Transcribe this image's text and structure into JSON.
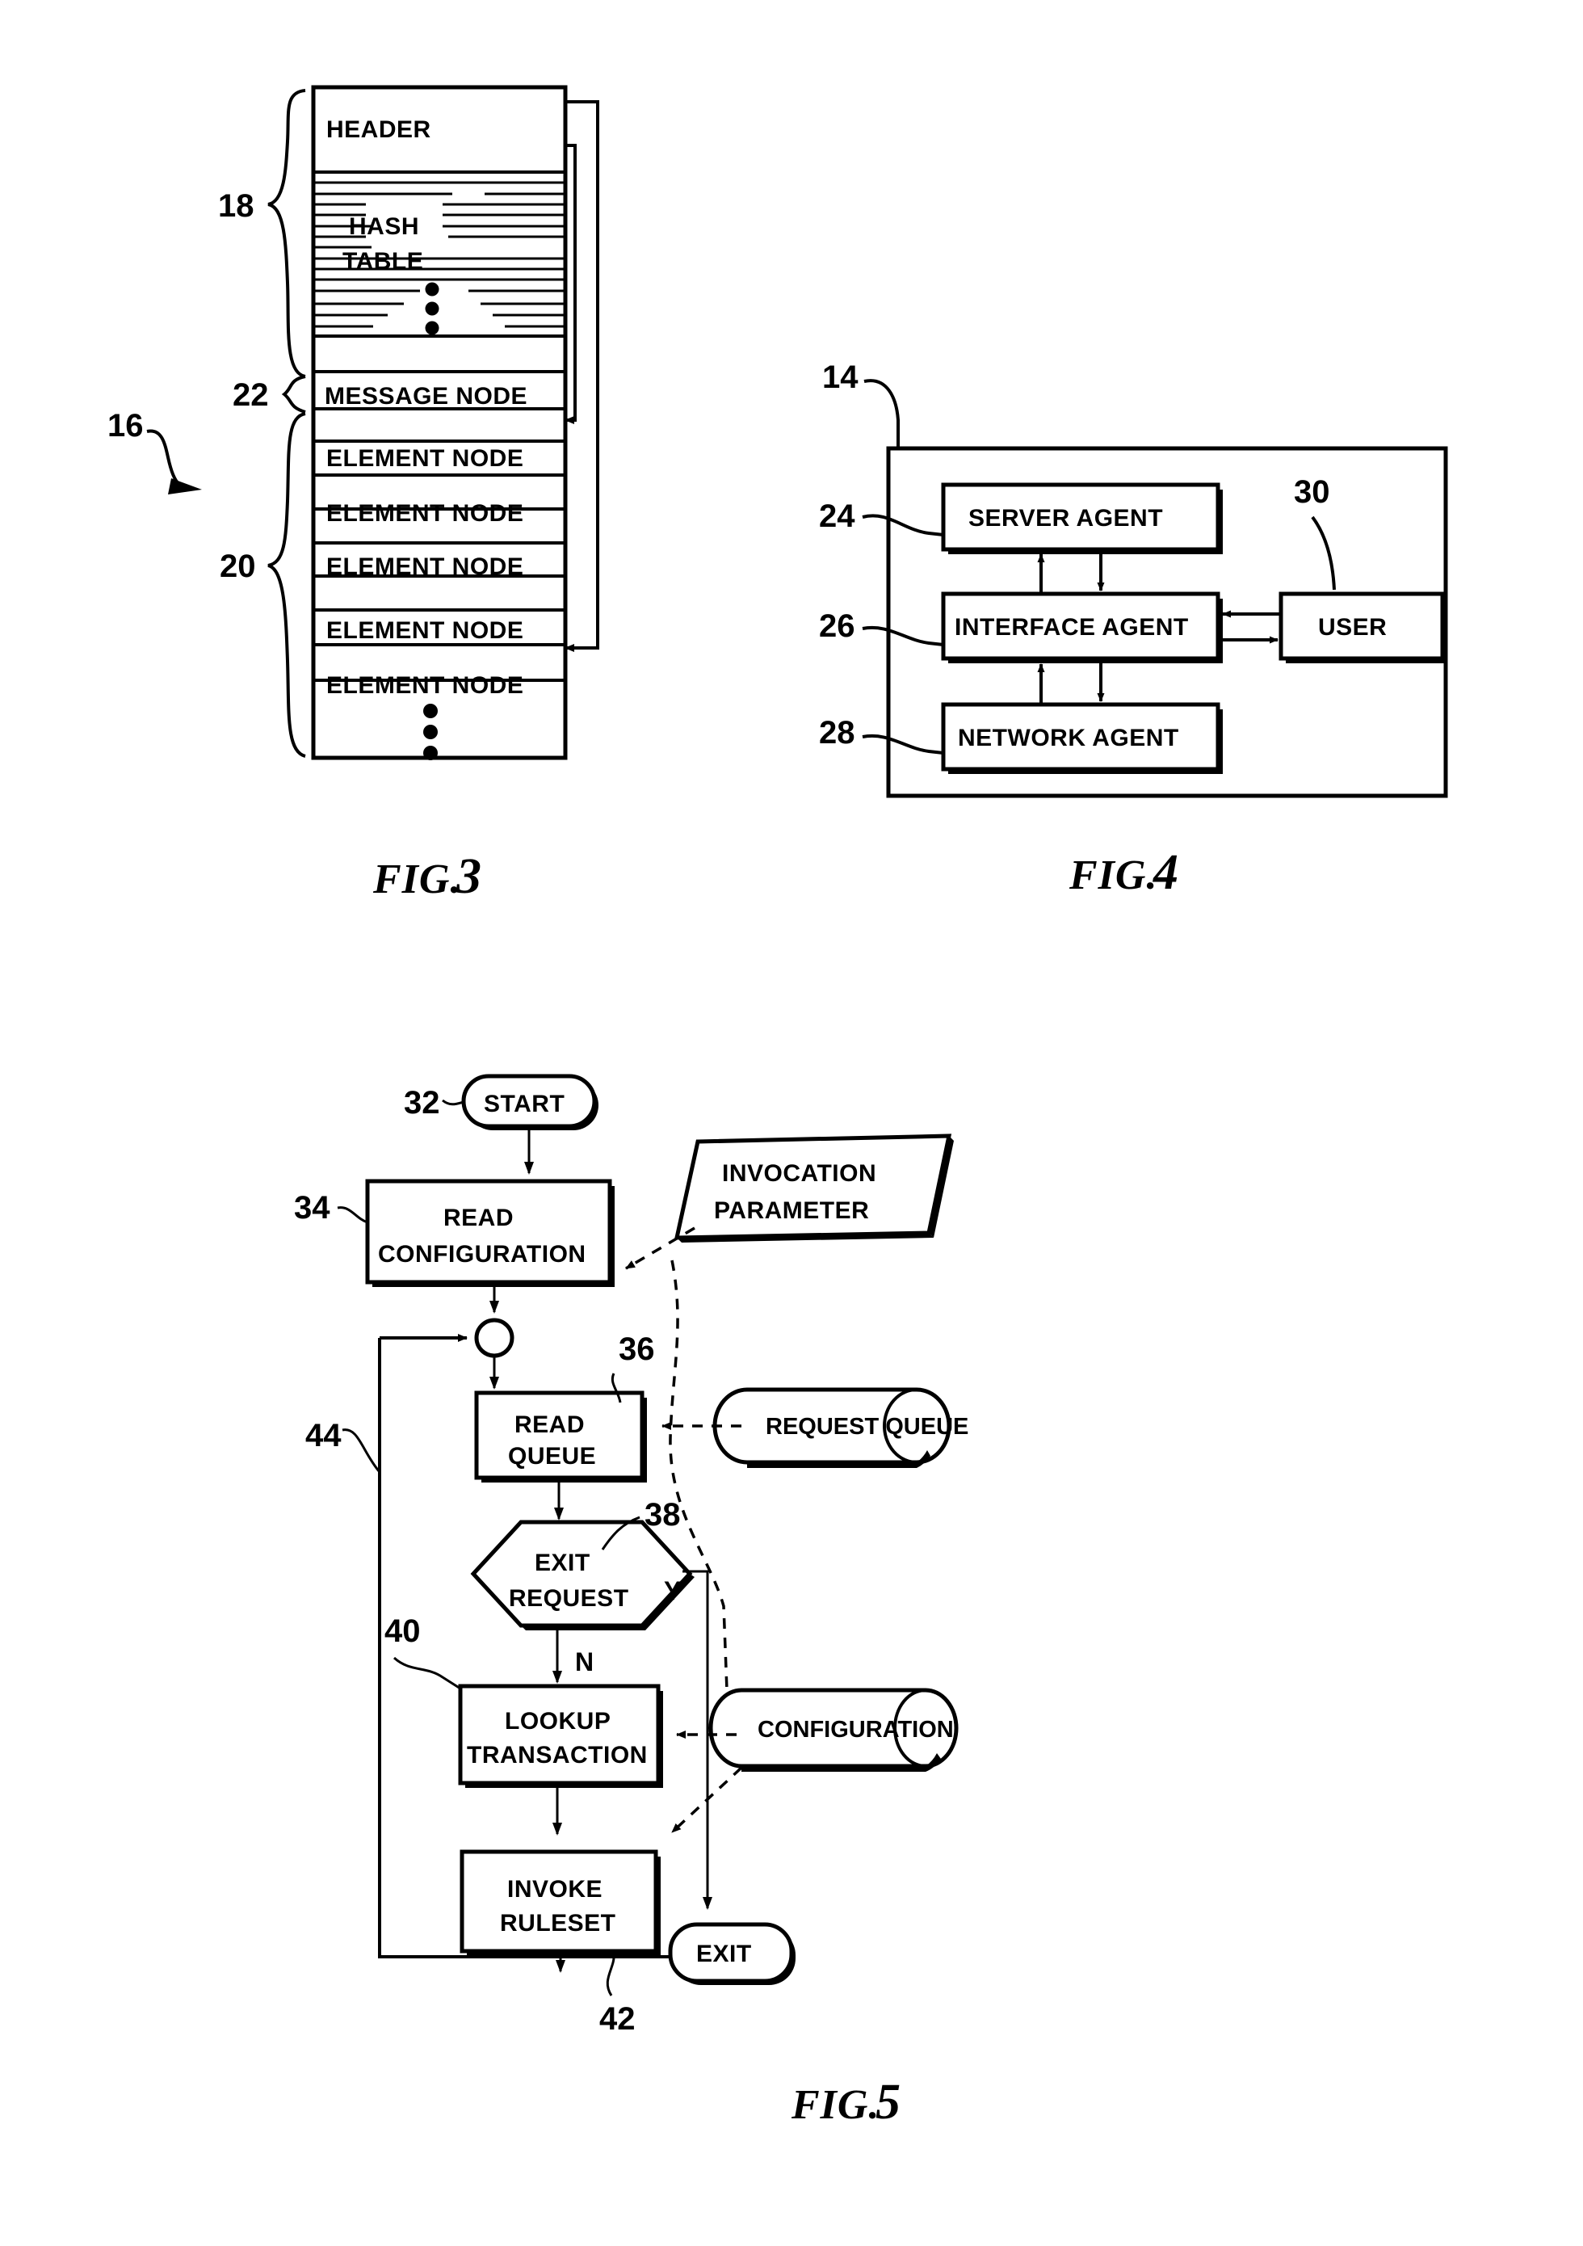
{
  "figures": [
    {
      "id": "fig3",
      "caption": "FIG.",
      "number": "3",
      "title_ref": "16",
      "refs": {
        "whole": "16",
        "hash_region": "18",
        "node_region": "20",
        "message_region": "22"
      },
      "rows": [
        {
          "label": "HEADER",
          "kind": "header"
        },
        {
          "label": "HASH TABLE",
          "kind": "hash"
        },
        {
          "label": "MESSAGE NODE",
          "kind": "node"
        },
        {
          "label": "ELEMENT NODE",
          "kind": "node"
        },
        {
          "label": "ELEMENT NODE",
          "kind": "node"
        },
        {
          "label": "ELEMENT NODE",
          "kind": "node"
        },
        {
          "label": "ELEMENT NODE",
          "kind": "node"
        },
        {
          "label": "ELEMENT NODE",
          "kind": "node"
        },
        {
          "label": "",
          "kind": "ellipsis"
        }
      ],
      "hash_lines_label_1": "HASH",
      "hash_lines_label_2": "TABLE"
    },
    {
      "id": "fig4",
      "caption": "FIG.",
      "number": "4",
      "refs": {
        "system": "14",
        "server_agent": "24",
        "interface_agent": "26",
        "network_agent": "28",
        "user": "30"
      },
      "boxes": [
        {
          "label": "SERVER AGENT",
          "ref": "24"
        },
        {
          "label": "INTERFACE AGENT",
          "ref": "26"
        },
        {
          "label": "NETWORK AGENT",
          "ref": "28"
        },
        {
          "label": "USER",
          "ref": "30"
        }
      ]
    },
    {
      "id": "fig5",
      "caption": "FIG.",
      "number": "5",
      "nodes": [
        {
          "label": "START",
          "ref": "32",
          "kind": "terminator"
        },
        {
          "label_1": "READ",
          "label_2": "CONFIGURATION",
          "ref": "34",
          "kind": "process"
        },
        {
          "label_1": "INVOCATION",
          "label_2": "PARAMETER",
          "ref": "",
          "kind": "io"
        },
        {
          "label_1": "READ",
          "label_2": "QUEUE",
          "ref": "36",
          "kind": "process"
        },
        {
          "label": "REQUEST QUEUE",
          "ref": "",
          "kind": "store"
        },
        {
          "label_1": "EXIT",
          "label_2": "REQUEST",
          "ref": "38",
          "kind": "decision"
        },
        {
          "label_1": "LOOKUP",
          "label_2": "TRANSACTION",
          "ref": "40",
          "kind": "process"
        },
        {
          "label": "CONFIGURATION",
          "ref": "",
          "kind": "store"
        },
        {
          "label_1": "INVOKE",
          "label_2": "RULESET",
          "ref": "42",
          "kind": "process"
        },
        {
          "label": "EXIT",
          "ref": "",
          "kind": "terminator"
        }
      ],
      "branch_yes": "Y",
      "branch_no": "N",
      "loop_ref": "44",
      "junction_ref": ""
    }
  ]
}
